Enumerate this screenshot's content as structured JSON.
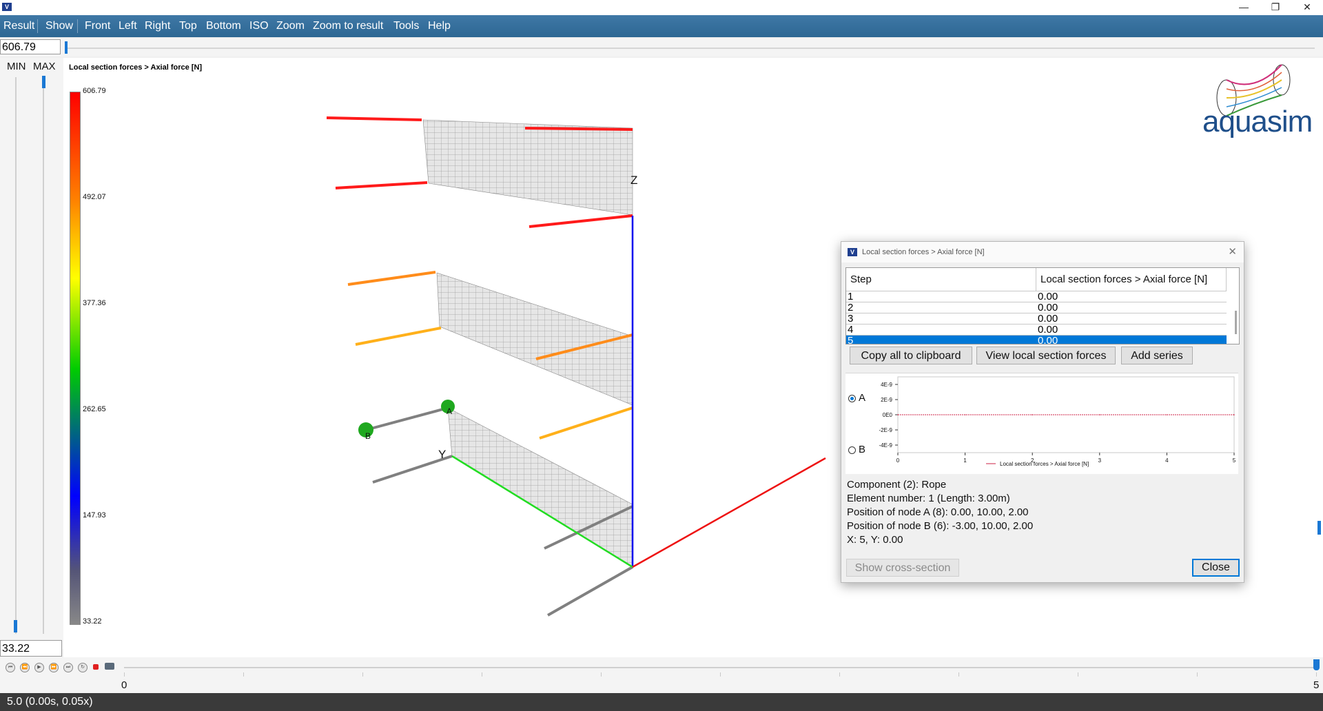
{
  "window": {
    "icon_text": "V",
    "min": "—",
    "max": "❐",
    "close": "✕"
  },
  "menu": [
    "Result",
    "Show",
    "Front",
    "Left",
    "Right",
    "Top",
    "Bottom",
    "ISO",
    "Zoom",
    "Zoom to result",
    "Tools",
    "Help"
  ],
  "range": {
    "max_value": "606.79",
    "min_value": "33.22",
    "min_label": "MIN",
    "max_label": "MAX"
  },
  "legend": {
    "title": "Local section forces > Axial force [N]",
    "ticks": [
      "606.79",
      "492.07",
      "377.36",
      "262.65",
      "147.93",
      "33.22"
    ]
  },
  "viewport": {
    "axis_z": "Z",
    "axis_y": "Y",
    "node_a": "A",
    "node_b": "B"
  },
  "logo": "aquasim",
  "timeline": {
    "start": "0",
    "end": "5"
  },
  "status": "5.0 (0.00s, 0.05x)",
  "dialog": {
    "title": "Local section forces > Axial force [N]",
    "columns": [
      "Step",
      "Local section forces > Axial force [N]"
    ],
    "rows": [
      {
        "step": "1",
        "value": "0.00"
      },
      {
        "step": "2",
        "value": "0.00"
      },
      {
        "step": "3",
        "value": "0.00"
      },
      {
        "step": "4",
        "value": "0.00"
      },
      {
        "step": "5",
        "value": "0.00"
      }
    ],
    "buttons": {
      "copy": "Copy all to clipboard",
      "view": "View local section forces",
      "add": "Add series"
    },
    "radio_a": "A",
    "radio_b": "B",
    "info": {
      "component": "Component (2): Rope",
      "element": "Element number: 1 (Length: 3.00m)",
      "node_a": "Position of node A (8): 0.00, 10.00, 2.00",
      "node_b": "Position of node B (6): -3.00, 10.00, 2.00",
      "xy": "X: 5, Y: 0.00"
    },
    "show_cross_section": "Show cross-section",
    "close": "Close"
  },
  "chart_data": {
    "type": "line",
    "x_ticks": [
      "0",
      "1",
      "2",
      "3",
      "4",
      "5"
    ],
    "y_ticks": [
      "4E-9",
      "2E-9",
      "0E0",
      "-2E-9",
      "-4E-9"
    ],
    "xlim": [
      0,
      5
    ],
    "ylim": [
      -5e-09,
      5e-09
    ],
    "series": [
      {
        "name": "Local section forces > Axial force [N]",
        "color": "#cc2244",
        "x": [
          0,
          1,
          2,
          3,
          4,
          5
        ],
        "y": [
          0,
          0,
          0,
          0,
          0,
          0
        ]
      }
    ]
  }
}
